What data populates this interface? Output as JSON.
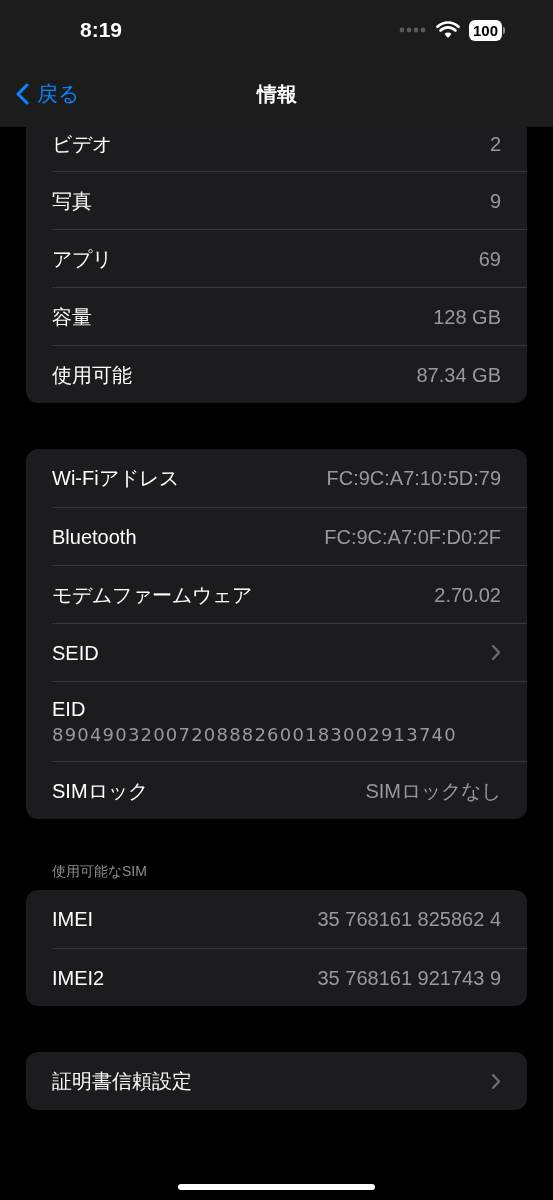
{
  "status_bar": {
    "time": "8:19",
    "battery": "100"
  },
  "nav": {
    "back": "戻る",
    "title": "情報"
  },
  "groups": [
    {
      "cut_top": true,
      "rows": [
        {
          "kind": "value",
          "label": "ビデオ",
          "value": "2"
        },
        {
          "kind": "value",
          "label": "写真",
          "value": "9"
        },
        {
          "kind": "value",
          "label": "アプリ",
          "value": "69"
        },
        {
          "kind": "value",
          "label": "容量",
          "value": "128 GB"
        },
        {
          "kind": "value",
          "label": "使用可能",
          "value": "87.34 GB"
        }
      ]
    },
    {
      "cut_top": false,
      "rows": [
        {
          "kind": "value",
          "label": "Wi-Fiアドレス",
          "value": "FC:9C:A7:10:5D:79"
        },
        {
          "kind": "value",
          "label": "Bluetooth",
          "value": "FC:9C:A7:0F:D0:2F"
        },
        {
          "kind": "value",
          "label": "モデムファームウェア",
          "value": "2.70.02"
        },
        {
          "kind": "chevron",
          "label": "SEID"
        },
        {
          "kind": "stacked",
          "label": "EID",
          "value": "89049032007208882600183002913740"
        },
        {
          "kind": "value",
          "label": "SIMロック",
          "value": "SIMロックなし"
        }
      ]
    },
    {
      "cut_top": false,
      "header": "使用可能なSIM",
      "rows": [
        {
          "kind": "value",
          "label": "IMEI",
          "value": "35 768161 825862 4"
        },
        {
          "kind": "value",
          "label": "IMEI2",
          "value": "35 768161 921743 9"
        }
      ]
    },
    {
      "cut_top": false,
      "rows": [
        {
          "kind": "chevron",
          "label": "証明書信頼設定"
        }
      ]
    }
  ]
}
